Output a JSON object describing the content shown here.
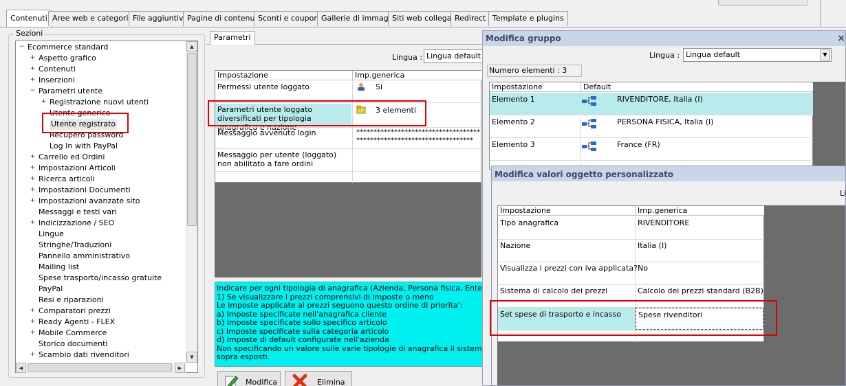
{
  "tabs": [
    {
      "label": "Contenuti",
      "active": true
    },
    {
      "label": "Aree web e categorie"
    },
    {
      "label": "File aggiuntivi"
    },
    {
      "label": "Pagine di contenuti"
    },
    {
      "label": "Sconti e coupon"
    },
    {
      "label": "Gallerie di immagini"
    },
    {
      "label": "Siti web collegati"
    },
    {
      "label": "Redirect"
    },
    {
      "label": "Template e plugins"
    }
  ],
  "sections": {
    "label": "Sezioni",
    "items": [
      {
        "label": "Ecommerce standard",
        "level": 0,
        "expander": "−"
      },
      {
        "label": "Aspetto grafico",
        "level": 1,
        "expander": "+"
      },
      {
        "label": "Contenuti",
        "level": 1,
        "expander": "+"
      },
      {
        "label": "Inserzioni",
        "level": 1,
        "expander": "+"
      },
      {
        "label": "Parametri utente",
        "level": 1,
        "expander": "−"
      },
      {
        "label": "Registrazione nuovi utenti",
        "level": 2,
        "expander": "+"
      },
      {
        "label": "Utente generico",
        "level": 2,
        "expander": ""
      },
      {
        "label": "Utente registrato",
        "level": 2,
        "expander": "",
        "selected": true
      },
      {
        "label": "Recupero password",
        "level": 2,
        "expander": ""
      },
      {
        "label": "Log In with PayPal",
        "level": 2,
        "expander": ""
      },
      {
        "label": "Carrello ed Ordini",
        "level": 1,
        "expander": "+"
      },
      {
        "label": "Impostazioni Articoli",
        "level": 1,
        "expander": "+"
      },
      {
        "label": "Ricerca articoli",
        "level": 1,
        "expander": "+"
      },
      {
        "label": "Impostazioni Documenti",
        "level": 1,
        "expander": "+"
      },
      {
        "label": "Impostazioni avanzate sito",
        "level": 1,
        "expander": "+"
      },
      {
        "label": "Messaggi e testi vari",
        "level": 1,
        "expander": ""
      },
      {
        "label": "Indicizzazione / SEO",
        "level": 1,
        "expander": "+"
      },
      {
        "label": "Lingue",
        "level": 1,
        "expander": ""
      },
      {
        "label": "Stringhe/Traduzioni",
        "level": 1,
        "expander": ""
      },
      {
        "label": "Pannello amministrativo",
        "level": 1,
        "expander": ""
      },
      {
        "label": "Mailing list",
        "level": 1,
        "expander": ""
      },
      {
        "label": "Spese trasporto/incasso gratuite",
        "level": 1,
        "expander": ""
      },
      {
        "label": "PayPal",
        "level": 1,
        "expander": ""
      },
      {
        "label": "Resi e riparazioni",
        "level": 1,
        "expander": ""
      },
      {
        "label": "Comparatori prezzi",
        "level": 1,
        "expander": "+"
      },
      {
        "label": "Ready Agenti - FLEX",
        "level": 1,
        "expander": "+"
      },
      {
        "label": "Mobile Commerce",
        "level": 1,
        "expander": "+"
      },
      {
        "label": "Storico documenti",
        "level": 1,
        "expander": ""
      },
      {
        "label": "Scambio dati rivenditori",
        "level": 1,
        "expander": "+"
      }
    ]
  },
  "params": {
    "tab": "Parametri",
    "lingua_label": "Lingua :",
    "lingua_value": "Lingua default",
    "col_setting": "Impostazione",
    "col_value": "Imp.generica",
    "rows": [
      {
        "setting": "Permessi utente loggato",
        "value": "Si"
      },
      {
        "setting": "Parametri utente loggato diversificati per tipologia anagrafica e nazione",
        "value": "3 elementi"
      },
      {
        "setting": "Messaggio avvenuto login",
        "value": "**********************************************************************"
      },
      {
        "setting": "Messaggio per utente (loggato) non abilitato a fare ordini",
        "value": ""
      }
    ],
    "help": "Indicare per ogni tipologia di anagrafica (Azienda, Persona fisica, Ente, ecc..) e n\n1) Se visualizzare i prezzi comprensivi di imposte o meno\nLe imposte applicate ai prezzi seguono questo ordine di priorita':\na) Imposte specificate nell'anagrafica cliente\nb) Imposte specificate sullo specifico articolo\nc) Imposte specificate sulla categoria articolo\nd) Imposte di default configurate nell'azienda\nNon specificando un valore sulle varie tipologie di anagrafica il sistema visualizzer\nsopra esposti.",
    "btn_edit": "Modifica",
    "btn_delete": "Elimina"
  },
  "group": {
    "title": "Modifica gruppo",
    "close": "×",
    "lingua_label": "Lingua :",
    "lingua_value": "Lingua default",
    "count": "Numero elementi : 3",
    "col_setting": "Impostazione",
    "col_default": "Default",
    "rows": [
      {
        "setting": "Elemento 1",
        "value": "RIVENDITORE, Italia (I)"
      },
      {
        "setting": "Elemento 2",
        "value": "PERSONA FISICA, Italia (I)"
      },
      {
        "setting": "Elemento 3",
        "value": "France (FR)"
      }
    ]
  },
  "custom": {
    "title": "Modifica valori oggetto personalizzato",
    "cut_text": "Lin",
    "col_setting": "Impostazione",
    "col_value": "Imp.generica",
    "rows": [
      {
        "setting": "Tipo anagrafica",
        "value": "RIVENDITORE"
      },
      {
        "setting": "Nazione",
        "value": "Italia (I)"
      },
      {
        "setting": "Visualizza i prezzi con iva applicata?",
        "value": "No"
      },
      {
        "setting": "Sistema di calcolo dei prezzi",
        "value": "Calcolo dei prezzi standard (B2B)"
      },
      {
        "setting": "Set spese di trasporto e incasso",
        "value": "Spese rivenditori"
      }
    ]
  },
  "colors": {
    "highlight": "#b8ecec",
    "help_bg": "#00f0f0",
    "red": "#e00000",
    "dark": "#6c6c6c"
  }
}
